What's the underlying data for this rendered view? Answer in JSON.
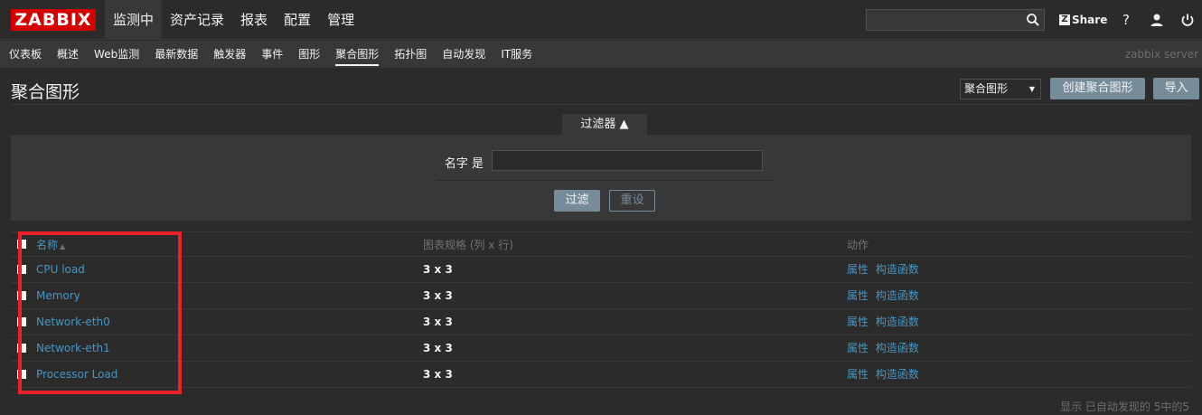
{
  "logo": "ZABBIX",
  "top_menu": [
    {
      "label": "监测中",
      "active": true
    },
    {
      "label": "资产记录",
      "active": false
    },
    {
      "label": "报表",
      "active": false
    },
    {
      "label": "配置",
      "active": false
    },
    {
      "label": "管理",
      "active": false
    }
  ],
  "share_label": "Share",
  "help_label": "?",
  "sub_menu": [
    {
      "label": "仪表板",
      "active": false
    },
    {
      "label": "概述",
      "active": false
    },
    {
      "label": "Web监测",
      "active": false
    },
    {
      "label": "最新数据",
      "active": false
    },
    {
      "label": "触发器",
      "active": false
    },
    {
      "label": "事件",
      "active": false
    },
    {
      "label": "图形",
      "active": false
    },
    {
      "label": "聚合图形",
      "active": true
    },
    {
      "label": "拓扑图",
      "active": false
    },
    {
      "label": "自动发现",
      "active": false
    },
    {
      "label": "IT服务",
      "active": false
    }
  ],
  "server_name": "zabbix server",
  "page": {
    "title": "聚合图形",
    "select_value": "聚合图形",
    "create_button": "创建聚合图形",
    "import_button": "导入"
  },
  "filter": {
    "tab_label": "过滤器 ▲",
    "name_label": "名字 是",
    "name_value": "",
    "apply_button": "过滤",
    "reset_button": "重设"
  },
  "table": {
    "headers": {
      "name": "名称",
      "size": "图表规格 (列 x 行)",
      "actions": "动作"
    },
    "rows": [
      {
        "name": "CPU load",
        "size": "3 x 3",
        "prop": "属性",
        "constructor": "构造函数"
      },
      {
        "name": "Memory",
        "size": "3 x 3",
        "prop": "属性",
        "constructor": "构造函数"
      },
      {
        "name": "Network-eth0",
        "size": "3 x 3",
        "prop": "属性",
        "constructor": "构造函数"
      },
      {
        "name": "Network-eth1",
        "size": "3 x 3",
        "prop": "属性",
        "constructor": "构造函数"
      },
      {
        "name": "Processor Load",
        "size": "3 x 3",
        "prop": "属性",
        "constructor": "构造函数"
      }
    ]
  },
  "footer_text": "显示 已自动发现的 5中的5",
  "colors": {
    "accent": "#768d99",
    "link": "#4796c4",
    "brand": "#d40000",
    "highlight": "#e8212b"
  }
}
